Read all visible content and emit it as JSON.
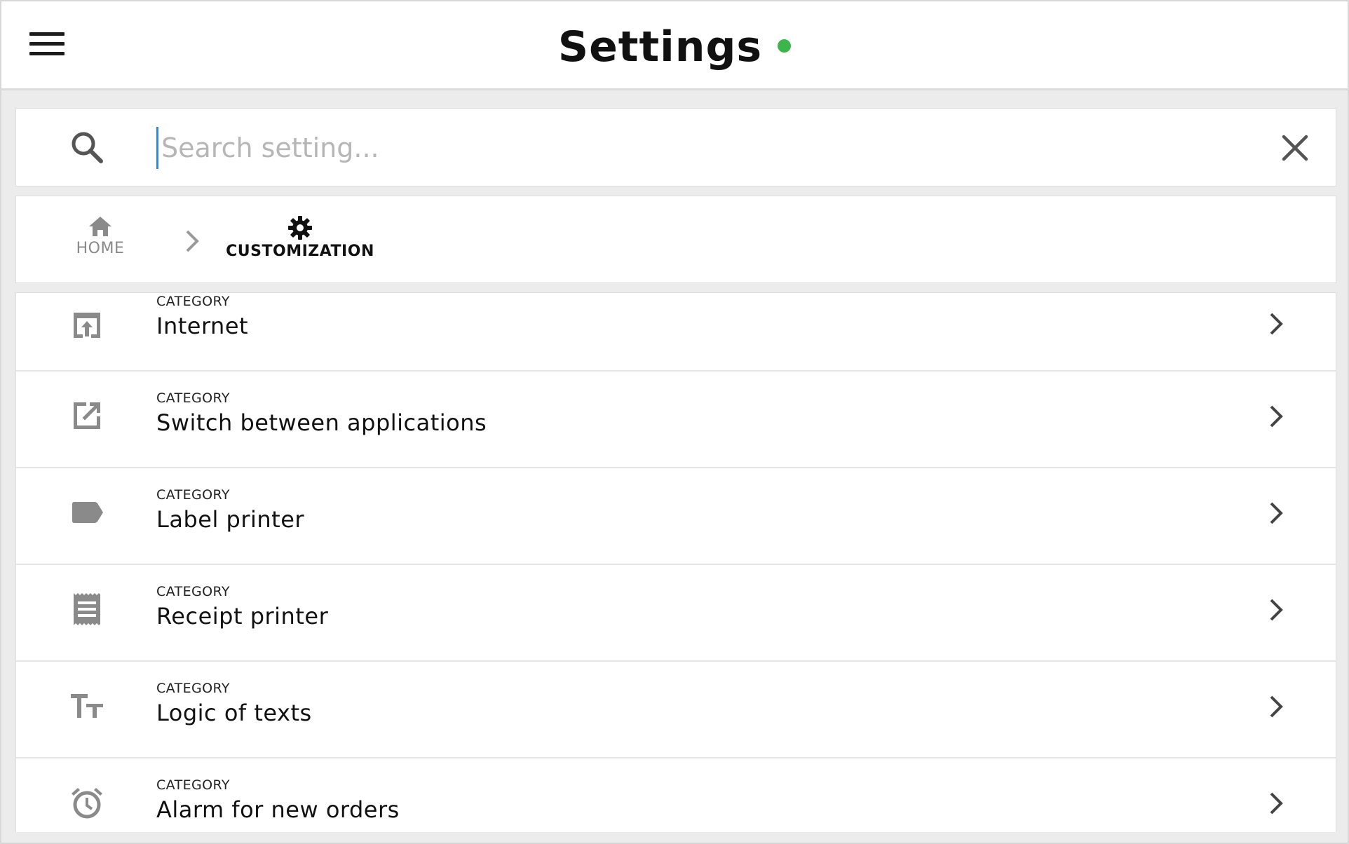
{
  "header": {
    "title": "Settings",
    "status_color": "#3cb54a"
  },
  "search": {
    "placeholder": "Search setting...",
    "value": ""
  },
  "breadcrumb": {
    "items": [
      {
        "label": "HOME",
        "icon": "home-icon"
      },
      {
        "label": "CUSTOMIZATION",
        "icon": "gear-icon"
      }
    ]
  },
  "categories": [
    {
      "kicker": "CATEGORY",
      "label": "Internet",
      "icon": "open-in-browser-icon"
    },
    {
      "kicker": "CATEGORY",
      "label": "Switch between applications",
      "icon": "open-in-new-icon"
    },
    {
      "kicker": "CATEGORY",
      "label": "Label printer",
      "icon": "label-icon"
    },
    {
      "kicker": "CATEGORY",
      "label": "Receipt printer",
      "icon": "receipt-icon"
    },
    {
      "kicker": "CATEGORY",
      "label": "Logic of texts",
      "icon": "text-size-icon"
    },
    {
      "kicker": "CATEGORY",
      "label": "Alarm for new orders",
      "icon": "alarm-icon"
    }
  ],
  "colors": {
    "icon_gray": "#8a8a8a",
    "accent": "#2d86e8"
  }
}
